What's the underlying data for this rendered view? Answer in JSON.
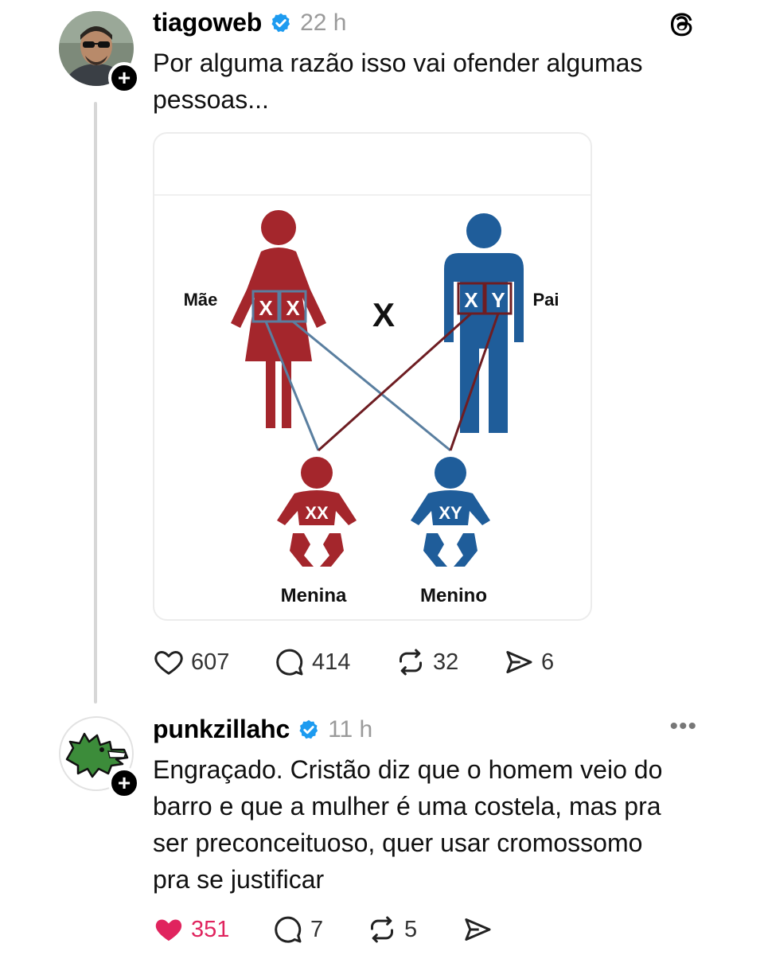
{
  "post1": {
    "username": "tiagoweb",
    "time": "22 h",
    "text_line1": "Por alguma razão isso vai ofender algumas",
    "text_line2": "pessoas...",
    "actions": {
      "likes": "607",
      "replies": "414",
      "reposts": "32",
      "shares": "6"
    },
    "image": {
      "mother_label": "Mãe",
      "father_label": "Pai",
      "cross_symbol": "X",
      "mother_chromosomes": [
        "X",
        "X"
      ],
      "father_chromosomes": [
        "X",
        "Y"
      ],
      "girl_chromosomes": "XX",
      "boy_chromosomes": "XY",
      "girl_label": "Menina",
      "boy_label": "Menino",
      "colors": {
        "female": "#a4262c",
        "male": "#1f5d9a",
        "link_blue": "#5a7fa0",
        "link_red": "#6e1d22"
      }
    }
  },
  "post2": {
    "username": "punkzillahc",
    "time": "11 h",
    "more": "•••",
    "text_lines": [
      "Engraçado. Cristão diz que o homem veio do",
      "barro e que a mulher é uma costela, mas pra",
      "ser preconceituoso, quer usar cromossomo",
      "pra se justificar"
    ],
    "actions": {
      "likes": "351",
      "replies": "7",
      "reposts": "5"
    }
  },
  "icons": [
    "threads-icon",
    "verified-icon",
    "heart-icon",
    "comment-icon",
    "repost-icon",
    "share-icon",
    "more-icon",
    "follow-plus-icon"
  ],
  "accent": {
    "verified": "#1d9bf0",
    "liked": "#e0245e"
  }
}
